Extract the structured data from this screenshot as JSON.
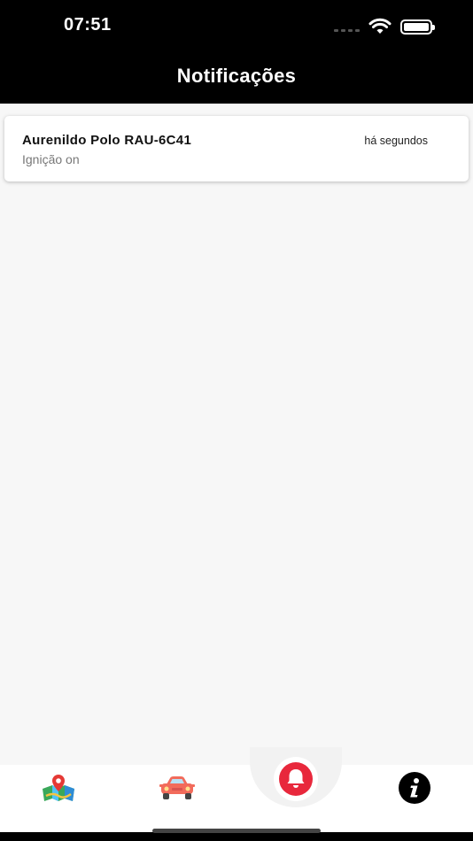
{
  "status_bar": {
    "time": "07:51"
  },
  "header": {
    "title": "Notificações"
  },
  "notifications": [
    {
      "title": "Aurenildo Polo RAU-6C41",
      "time": "há segundos",
      "message": "Ignição on"
    }
  ],
  "tabbar": {
    "items": [
      {
        "icon": "map-pin-icon"
      },
      {
        "icon": "car-icon"
      },
      {
        "icon": "bell-icon",
        "active": true
      },
      {
        "icon": "info-icon"
      }
    ]
  },
  "colors": {
    "header_bg": "#000000",
    "accent": "#e8283c",
    "background": "#f7f7f7"
  }
}
